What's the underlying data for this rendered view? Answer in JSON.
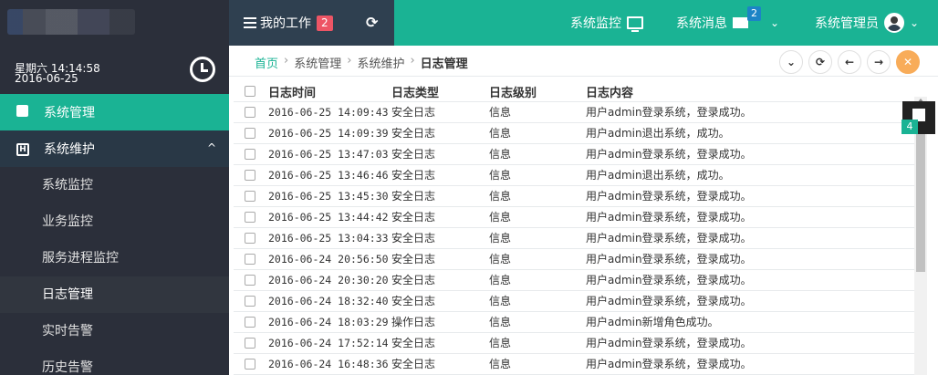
{
  "header": {
    "my_work_label": "我的工作",
    "my_work_badge": "2",
    "system_monitor_label": "系统监控",
    "system_messages_label": "系统消息",
    "messages_badge": "2",
    "user_label": "系统管理员",
    "accent_color": "#1ab394"
  },
  "sidebar": {
    "day": "星期六 14:14:58",
    "date": "2016-06-25",
    "items": [
      {
        "label": "系统管理",
        "icon": "puzzle-icon"
      },
      {
        "label": "系统维护",
        "icon": "h-square-icon"
      }
    ],
    "subitems": [
      "系统监控",
      "业务监控",
      "服务进程监控",
      "日志管理",
      "实时告警",
      "历史告警"
    ]
  },
  "breadcrumb": {
    "home": "首页",
    "level1": "系统管理",
    "level2": "系统维护",
    "current": "日志管理"
  },
  "table": {
    "headers": [
      "日志时间",
      "日志类型",
      "日志级别",
      "日志内容"
    ],
    "rows": [
      [
        "2016-06-25 14:09:43",
        "安全日志",
        "信息",
        "用户admin登录系统，登录成功。"
      ],
      [
        "2016-06-25 14:09:39",
        "安全日志",
        "信息",
        "用户admin退出系统，成功。"
      ],
      [
        "2016-06-25 13:47:03",
        "安全日志",
        "信息",
        "用户admin登录系统，登录成功。"
      ],
      [
        "2016-06-25 13:46:46",
        "安全日志",
        "信息",
        "用户admin退出系统，成功。"
      ],
      [
        "2016-06-25 13:45:30",
        "安全日志",
        "信息",
        "用户admin登录系统，登录成功。"
      ],
      [
        "2016-06-25 13:44:42",
        "安全日志",
        "信息",
        "用户admin登录系统，登录成功。"
      ],
      [
        "2016-06-25 13:04:33",
        "安全日志",
        "信息",
        "用户admin登录系统，登录成功。"
      ],
      [
        "2016-06-24 20:56:50",
        "安全日志",
        "信息",
        "用户admin登录系统，登录成功。"
      ],
      [
        "2016-06-24 20:30:20",
        "安全日志",
        "信息",
        "用户admin登录系统，登录成功。"
      ],
      [
        "2016-06-24 18:32:40",
        "安全日志",
        "信息",
        "用户admin登录系统，登录成功。"
      ],
      [
        "2016-06-24 18:03:29",
        "操作日志",
        "信息",
        "用户admin新增角色成功。"
      ],
      [
        "2016-06-24 17:52:14",
        "安全日志",
        "信息",
        "用户admin登录系统，登录成功。"
      ],
      [
        "2016-06-24 16:48:36",
        "安全日志",
        "信息",
        "用户admin登录系统，登录成功。"
      ]
    ]
  },
  "float_badge": "4"
}
